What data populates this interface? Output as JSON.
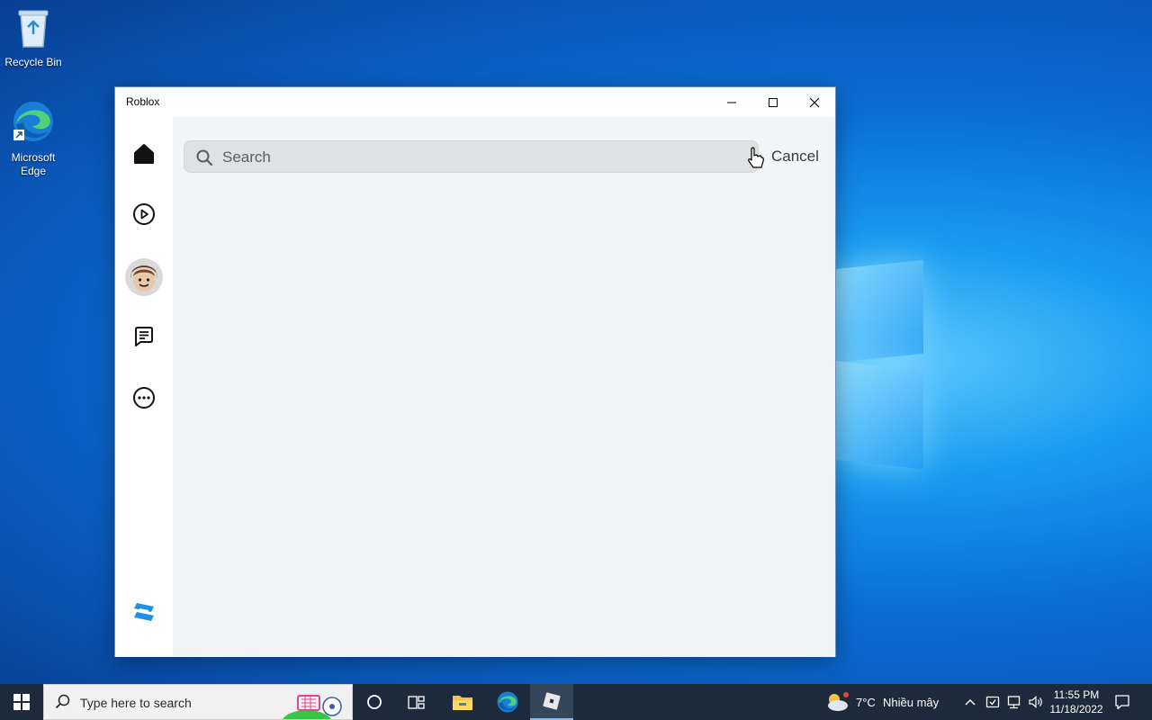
{
  "desktop": {
    "icons": [
      {
        "label": "Recycle Bin",
        "icon": "recycle-bin-icon"
      },
      {
        "label": "Microsoft Edge",
        "icon": "edge-icon"
      }
    ]
  },
  "window": {
    "title": "Roblox",
    "controls": [
      "minimize-icon",
      "maximize-icon",
      "close-icon"
    ]
  },
  "sidebar": {
    "items": [
      {
        "name": "home",
        "icon": "home-icon"
      },
      {
        "name": "play",
        "icon": "play-circle-icon"
      },
      {
        "name": "avatar",
        "icon": "avatar-icon"
      },
      {
        "name": "chat",
        "icon": "chat-icon"
      },
      {
        "name": "more",
        "icon": "more-icon"
      }
    ],
    "bottom_icon": "roblox-studio-icon"
  },
  "search": {
    "placeholder": "Search",
    "cancel_label": "Cancel"
  },
  "taskbar": {
    "search_placeholder": "Type here to search",
    "weather": {
      "temp": "7°C",
      "condition": "Nhiều mây"
    },
    "clock": {
      "time": "11:55 PM",
      "date": "11/18/2022"
    },
    "apps": [
      "cortana-icon",
      "task-view-icon",
      "file-explorer-icon",
      "edge-icon",
      "roblox-icon"
    ]
  },
  "colors": {
    "taskbar_bg": "#1c2a3c",
    "content_bg": "#f2f4f5",
    "search_bg": "#dfe1e3"
  }
}
